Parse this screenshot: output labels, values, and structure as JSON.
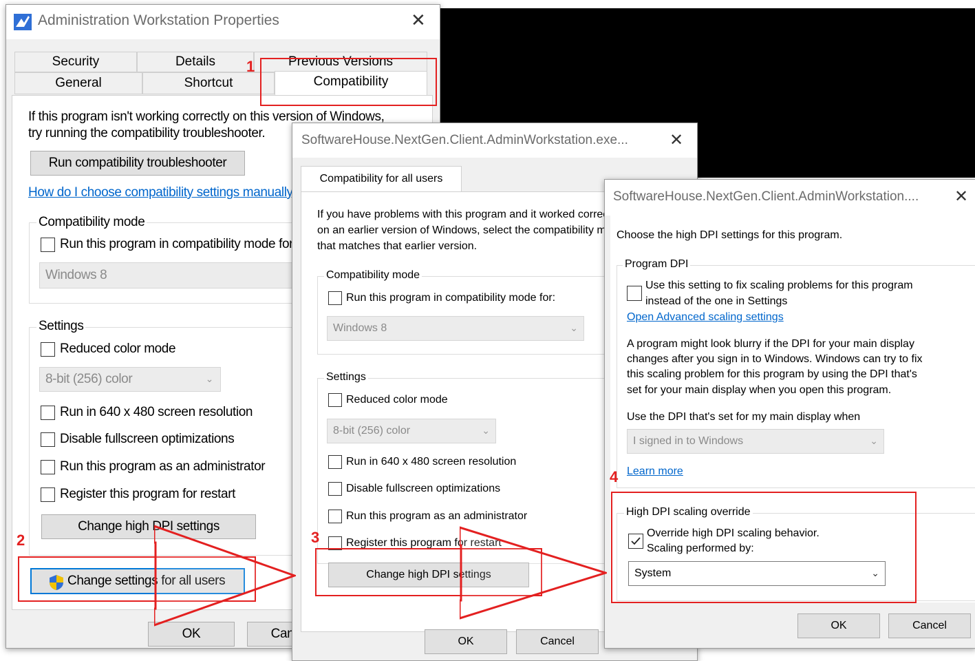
{
  "accent_red": "#e32020",
  "link_color": "#0066cc",
  "dialog1": {
    "title": "Administration Workstation Properties",
    "close_icon": "close-icon",
    "tabs_row1": [
      "Security",
      "Details",
      "Previous Versions"
    ],
    "tabs_row2": [
      "General",
      "Shortcut",
      "Compatibility"
    ],
    "intro_line1": "If this program isn't working correctly on this version of Windows,",
    "intro_line2": "try running the compatibility troubleshooter.",
    "run_troubleshooter": "Run compatibility troubleshooter",
    "how_link": "How do I choose compatibility settings manually?",
    "compat_mode_label": "Compatibility mode",
    "compat_checkbox": "Run this program in compatibility mode for:",
    "compat_select": "Windows 8",
    "settings_label": "Settings",
    "reduced_color": "Reduced color mode",
    "color_select": "8-bit (256) color",
    "run_640": "Run in 640 x 480 screen resolution",
    "disable_fullscreen": "Disable fullscreen optimizations",
    "run_admin": "Run this program as an administrator",
    "register_restart": "Register this program for restart",
    "change_dpi": "Change high DPI settings",
    "change_all_users": "Change settings for all users",
    "ok": "OK",
    "cancel": "Cancel"
  },
  "dialog2": {
    "title": "SoftwareHouse.NextGen.Client.AdminWorkstation.exe...",
    "tab": "Compatibility for all users",
    "intro_line1": "If you have problems with this program and it worked correctly",
    "intro_line2": "on an earlier version of Windows, select the compatibility mode",
    "intro_line3": "that matches that earlier version.",
    "compat_mode_label": "Compatibility mode",
    "compat_checkbox": "Run this program in compatibility mode for:",
    "compat_select": "Windows 8",
    "settings_label": "Settings",
    "reduced_color": "Reduced color mode",
    "color_select": "8-bit (256) color",
    "run_640": "Run in 640 x 480 screen resolution",
    "disable_fullscreen": "Disable fullscreen optimizations",
    "run_admin": "Run this program as an administrator",
    "register_restart": "Register this program for restart",
    "change_dpi": "Change high DPI settings",
    "ok": "OK",
    "cancel": "Cancel"
  },
  "dialog3": {
    "title": "SoftwareHouse.NextGen.Client.AdminWorkstation....",
    "heading": "Choose the high DPI settings for this program.",
    "program_dpi_label": "Program DPI",
    "program_dpi_cb_line1": "Use this setting to fix scaling problems for this program",
    "program_dpi_cb_line2": "instead of the one in Settings",
    "open_scaling_link": "Open Advanced scaling settings",
    "blurry_line1": "A program might look blurry if the DPI for your main display",
    "blurry_line2": "changes after you sign in to Windows. Windows can try to fix",
    "blurry_line3": "this scaling problem for this program by using the DPI that's",
    "blurry_line4": "set for your main display when you open this program.",
    "use_dpi_label": "Use the DPI that's set for my main display when",
    "signin_select": "I signed in to Windows",
    "learn_more": "Learn more",
    "override_label": "High DPI scaling override",
    "override_cb_line1": "Override high DPI scaling behavior.",
    "override_cb_line2": "Scaling performed by:",
    "override_checked": true,
    "scaling_select": "System",
    "ok": "OK",
    "cancel": "Cancel"
  },
  "steps": [
    "1",
    "2",
    "3",
    "4"
  ]
}
